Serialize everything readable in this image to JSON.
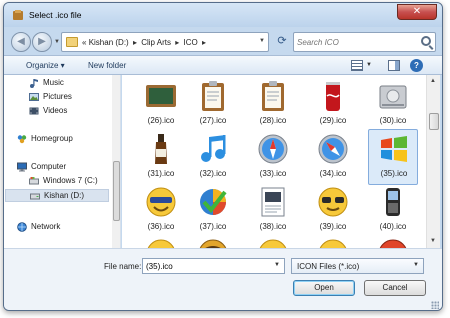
{
  "window": {
    "title": "Select .ico file",
    "close_label": "✕"
  },
  "nav": {
    "breadcrumb_prefix": "«",
    "breadcrumb": [
      "Kishan (D:)",
      "Clip Arts",
      "ICO"
    ],
    "search_placeholder": "Search ICO"
  },
  "toolbar": {
    "organize_label": "Organize ▾",
    "new_folder_label": "New folder"
  },
  "sidebar": {
    "items": [
      {
        "label": "Music",
        "icon": "music-icon"
      },
      {
        "label": "Pictures",
        "icon": "pictures-icon"
      },
      {
        "label": "Videos",
        "icon": "videos-icon"
      },
      {
        "label": "Homegroup",
        "icon": "homegroup-icon"
      },
      {
        "label": "Computer",
        "icon": "computer-icon"
      },
      {
        "label": "Windows 7 (C:)",
        "icon": "drive-c-icon"
      },
      {
        "label": "Kishan (D:)",
        "icon": "drive-d-icon",
        "selected": true
      },
      {
        "label": "Network",
        "icon": "network-icon"
      }
    ]
  },
  "files": [
    {
      "label": "(26).ico",
      "icon": "chalkboard-icon"
    },
    {
      "label": "(27).ico",
      "icon": "clipboard-icon"
    },
    {
      "label": "(28).ico",
      "icon": "clipboard-icon"
    },
    {
      "label": "(29).ico",
      "icon": "soda-can-icon"
    },
    {
      "label": "(30).ico",
      "icon": "hard-drive-icon"
    },
    {
      "label": "(31).ico",
      "icon": "bottle-icon"
    },
    {
      "label": "(32).ico",
      "icon": "music-note-icon"
    },
    {
      "label": "(33).ico",
      "icon": "safari-compass-icon"
    },
    {
      "label": "(34).ico",
      "icon": "safari-compass-icon"
    },
    {
      "label": "(35).ico",
      "icon": "windows-logo-icon",
      "selected": true
    },
    {
      "label": "(36).ico",
      "icon": "smiley-icon"
    },
    {
      "label": "(37).ico",
      "icon": "checkmark-pie-icon"
    },
    {
      "label": "(38).ico",
      "icon": "document-icon"
    },
    {
      "label": "(39).ico",
      "icon": "sunglasses-smiley-icon"
    },
    {
      "label": "(40).ico",
      "icon": "phone-icon"
    },
    {
      "label": "",
      "icon": "sad-smiley-icon"
    },
    {
      "label": "",
      "icon": "smiley-icon"
    },
    {
      "label": "",
      "icon": "sad-smiley-icon"
    },
    {
      "label": "",
      "icon": "crying-smiley-icon"
    },
    {
      "label": "",
      "icon": "angry-smiley-icon"
    }
  ],
  "bottom": {
    "filename_label": "File name:",
    "filename_value": "(35).ico",
    "filetype_value": "ICON Files (*.ico)",
    "open_label": "Open",
    "cancel_label": "Cancel"
  }
}
